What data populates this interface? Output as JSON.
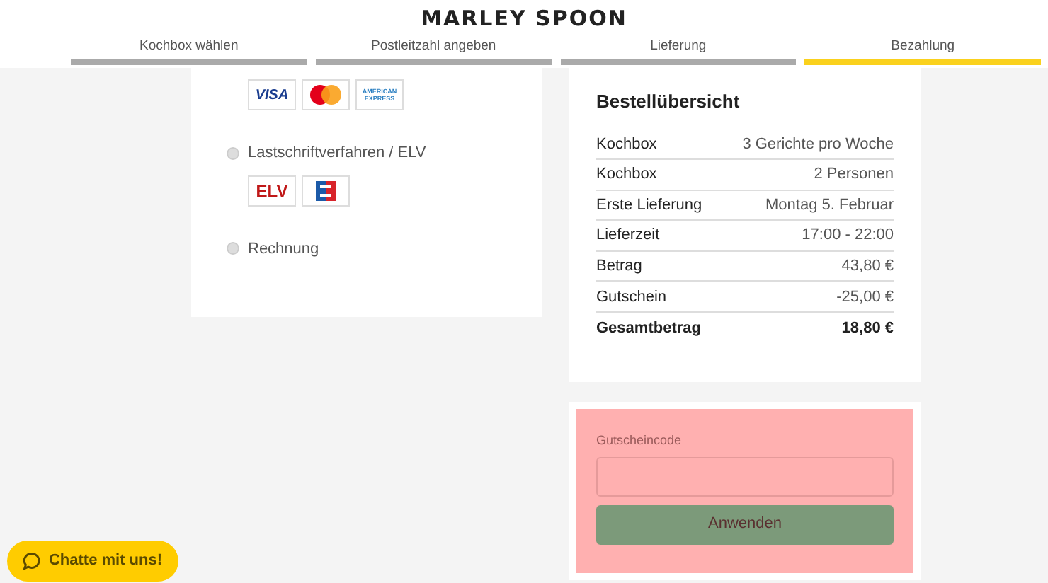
{
  "header": {
    "logo": "MARLEY SPOON"
  },
  "steps": [
    {
      "label": "Kochbox wählen",
      "selected": false
    },
    {
      "label": "Postleitzahl angeben",
      "selected": false
    },
    {
      "label": "Lieferung",
      "selected": false
    },
    {
      "label": "Bezahlung",
      "selected": true
    }
  ],
  "payment_methods": [
    {
      "kind": "logos",
      "logos": [
        {
          "kind": "visa",
          "label": "VISA"
        },
        {
          "kind": "mastercard"
        },
        {
          "kind": "amex",
          "label": "AMERICAN EXPRESS"
        }
      ]
    },
    {
      "kind": "option",
      "label": "Lastschriftverfahren / ELV",
      "selected": false,
      "logos": [
        {
          "kind": "elv",
          "label": "ELV"
        },
        {
          "kind": "ec"
        }
      ]
    },
    {
      "kind": "option",
      "label": "Rechnung",
      "selected": false
    }
  ],
  "summary": {
    "title": "Bestellübersicht",
    "rows": [
      {
        "label": "Kochbox",
        "value": "3 Gerichte pro Woche",
        "total": false
      },
      {
        "label": "Kochbox",
        "value": "2 Personen",
        "total": false
      },
      {
        "label": "Erste Lieferung",
        "value": "Montag 5. Februar",
        "total": false
      },
      {
        "label": "Lieferzeit",
        "value": "17:00 - 22:00",
        "total": false
      },
      {
        "label": "Betrag",
        "value": "43,80 €",
        "total": false
      },
      {
        "label": "Gutschein",
        "value": "-25,00 €",
        "total": false
      },
      {
        "label": "Gesamtbetrag",
        "value": "18,80 €",
        "total": true
      }
    ]
  },
  "voucher": {
    "label": "Gutscheincode",
    "button": "Anwenden"
  },
  "chat": {
    "label": "Chatte mit uns!"
  }
}
